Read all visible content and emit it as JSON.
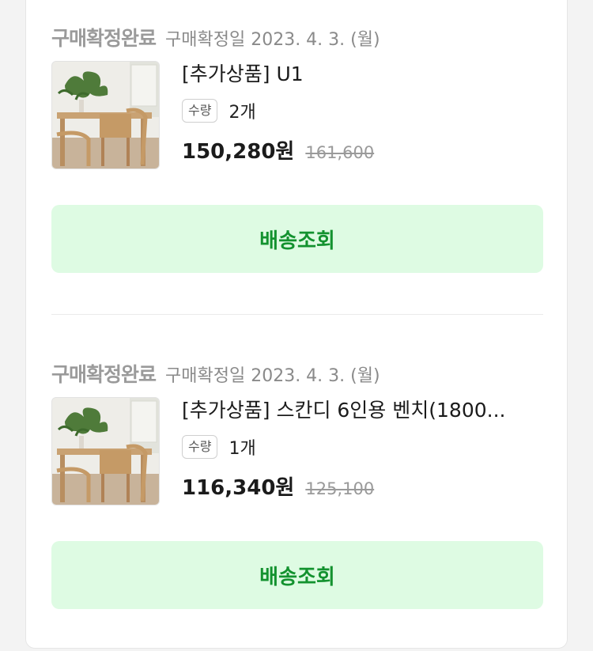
{
  "orders": [
    {
      "status": "구매확정완료",
      "date": "구매확정일 2023. 4. 3. (월)",
      "product_name": "[추가상품] U1",
      "qty_label": "수량",
      "qty_value": "2개",
      "price": "150,280원",
      "original_price": "161,600",
      "ship_button": "배송조회"
    },
    {
      "status": "구매확정완료",
      "date": "구매확정일 2023. 4. 3. (월)",
      "product_name": "[추가상품] 스칸디 6인용 벤치(1800...",
      "qty_label": "수량",
      "qty_value": "1개",
      "price": "116,340원",
      "original_price": "125,100",
      "ship_button": "배송조회"
    }
  ],
  "colors": {
    "ship_button_bg": "#defbe3",
    "ship_button_text": "#13922f"
  }
}
